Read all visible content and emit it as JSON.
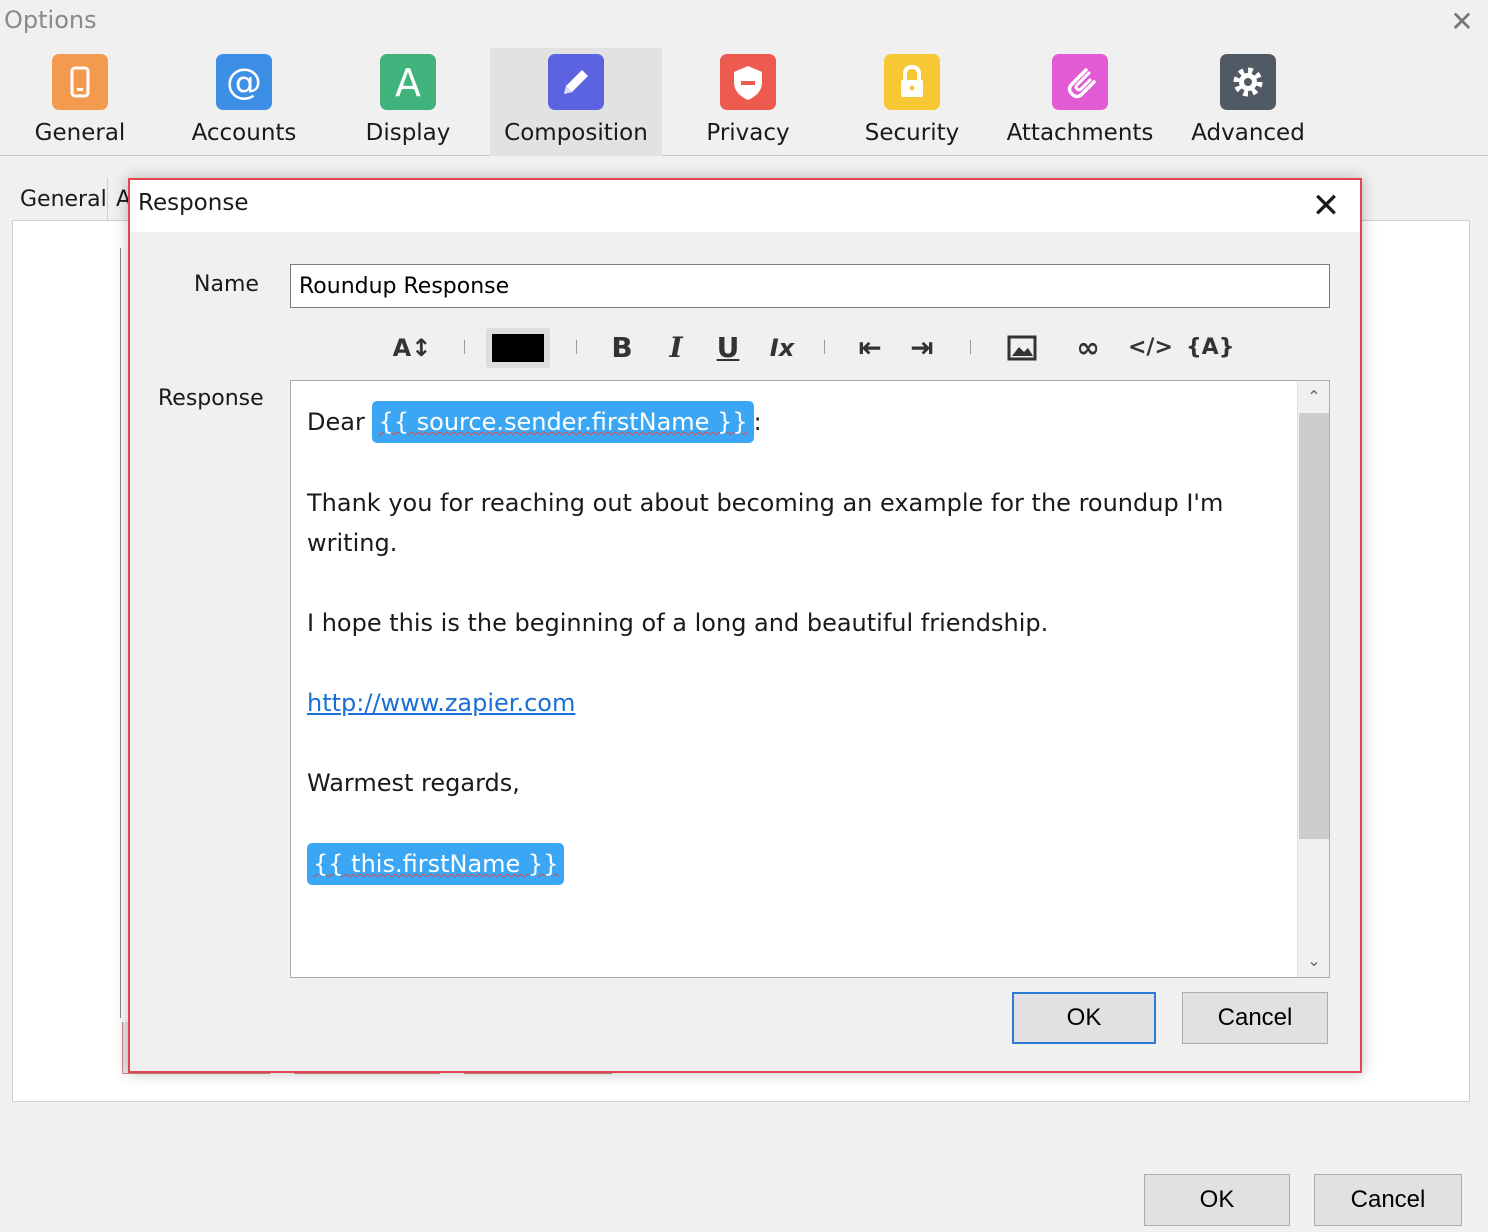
{
  "window": {
    "title": "Options",
    "close_glyph": "✕"
  },
  "toolbar": {
    "items": [
      {
        "label": "General",
        "icon": "phone-icon",
        "color": "#f39a4f"
      },
      {
        "label": "Accounts",
        "icon": "at-icon",
        "color": "#3d8fe6"
      },
      {
        "label": "Display",
        "icon": "letter-a-icon",
        "color": "#3fb37b"
      },
      {
        "label": "Composition",
        "icon": "pencil-icon",
        "color": "#5b63e0",
        "active": true
      },
      {
        "label": "Privacy",
        "icon": "shield-icon",
        "color": "#ec5a50"
      },
      {
        "label": "Security",
        "icon": "lock-icon",
        "color": "#f7c834"
      },
      {
        "label": "Attachments",
        "icon": "paperclip-icon",
        "color": "#e25ad4"
      },
      {
        "label": "Advanced",
        "icon": "gear-icon",
        "color": "#505964"
      }
    ]
  },
  "subtabs": [
    "General",
    "A"
  ],
  "footer": {
    "ok_label": "OK",
    "cancel_label": "Cancel"
  },
  "dialog": {
    "title": "Response",
    "close_glyph": "✕",
    "name_label": "Name",
    "name_value": "Roundup Response",
    "response_label": "Response",
    "format_bar": {
      "font_size": "A↕",
      "text_color": "#000000",
      "bold": "B",
      "italic": "I",
      "underline": "U",
      "clear_format": "Ix",
      "outdent": "⇤",
      "indent": "⇥",
      "image": "🖼",
      "link": "∞",
      "code": "</>",
      "variable": "{A}"
    },
    "body": {
      "greeting_prefix": "Dear",
      "greeting_token": "{{ source.sender.firstName }}",
      "greeting_suffix": ":",
      "paragraph1": "Thank you for reaching out about becoming an example for the roundup I'm writing.",
      "paragraph2": "I hope this is the beginning of a long and beautiful friendship.",
      "link": "http://www.zapier.com",
      "closing": "Warmest regards,",
      "signature_token": "{{ this.firstName }}"
    },
    "ok_label": "OK",
    "cancel_label": "Cancel"
  }
}
